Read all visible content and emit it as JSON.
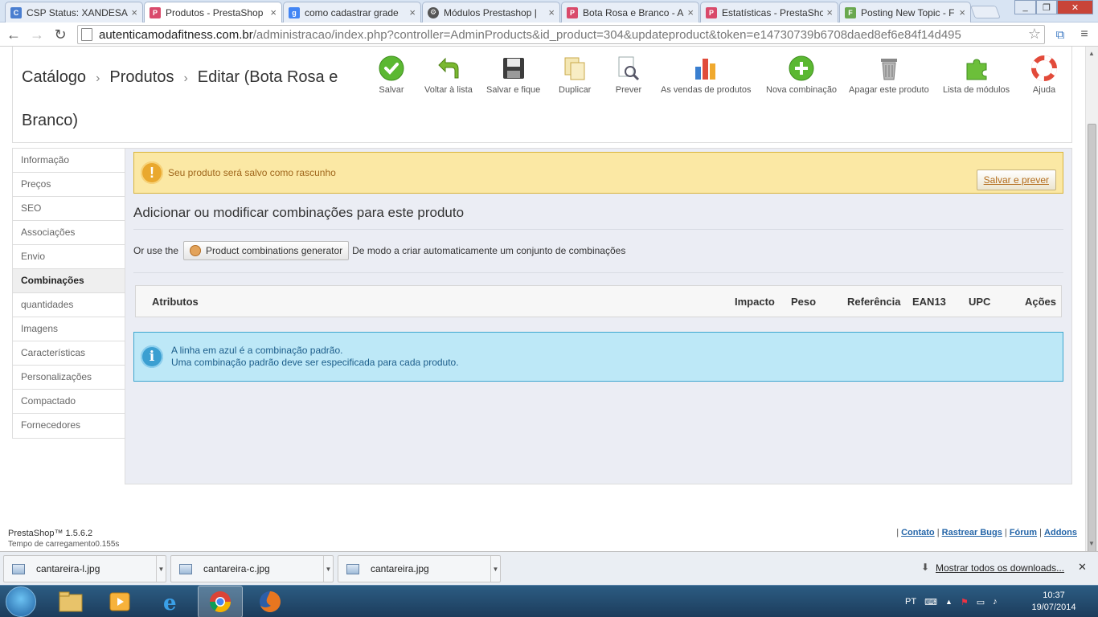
{
  "browser": {
    "tabs": [
      {
        "title": "CSP Status: XANDESA",
        "favicon": "csp",
        "active": false
      },
      {
        "title": "Produtos - PrestaShop",
        "favicon": "prestashop",
        "active": true
      },
      {
        "title": "como cadastrar grade",
        "favicon": "google",
        "active": false
      },
      {
        "title": "Módulos Prestashop |",
        "favicon": "gear",
        "active": false
      },
      {
        "title": "Bota Rosa e Branco - A",
        "favicon": "prestashop",
        "active": false
      },
      {
        "title": "Estatísticas - PrestaSho",
        "favicon": "prestashop",
        "active": false
      },
      {
        "title": "Posting New Topic - F",
        "favicon": "forum",
        "active": false
      }
    ],
    "url_host": "autenticamodafitness.com.br",
    "url_path": "/administracao/index.php?controller=AdminProducts&id_product=304&updateproduct&token=e14730739b6708daed8ef6e84f14d495"
  },
  "breadcrumb": {
    "items": [
      "Catálogo",
      "Produtos",
      "Editar (Bota Rosa e Branco)"
    ],
    "separator": "›"
  },
  "toolbar": {
    "buttons": [
      {
        "label": "Salvar",
        "icon": "check-icon"
      },
      {
        "label": "Voltar à lista",
        "icon": "back-arrow-icon"
      },
      {
        "label": "Salvar e fique",
        "icon": "floppy-icon"
      },
      {
        "label": "Duplicar",
        "icon": "duplicate-icon"
      },
      {
        "label": "Prever",
        "icon": "preview-icon"
      },
      {
        "label": "As vendas de produtos",
        "icon": "bar-chart-icon"
      },
      {
        "label": "Nova combinação",
        "icon": "plus-icon"
      },
      {
        "label": "Apagar este produto",
        "icon": "trash-icon"
      },
      {
        "label": "Lista de módulos",
        "icon": "puzzle-icon"
      },
      {
        "label": "Ajuda",
        "icon": "lifebuoy-icon"
      }
    ]
  },
  "sidetabs": [
    "Informação",
    "Preços",
    "SEO",
    "Associações",
    "Envio",
    "Combinações",
    "quantidades",
    "Imagens",
    "Características",
    "Personalizações",
    "Compactado",
    "Fornecedores"
  ],
  "sidetabs_active": "Combinações",
  "warning": {
    "message": "Seu produto será salvo como rascunho",
    "button": "Salvar e prever"
  },
  "combinations": {
    "title": "Adicionar ou modificar combinações para este produto",
    "or_use": "Or use the",
    "generator_button": "Product combinations generator",
    "generator_suffix": "De modo a criar automaticamente um conjunto de combinações",
    "columns": [
      "Atributos",
      "Impacto",
      "Peso",
      "Referência",
      "EAN13",
      "UPC",
      "Ações"
    ]
  },
  "info": {
    "line1": "A linha em azul é a combinação padrão.",
    "line2": "Uma combinação padrão deve ser especificada para cada produto."
  },
  "footer": {
    "version": "PrestaShop™ 1.5.6.2",
    "load_time": "Tempo de carregamento0.155s",
    "links": [
      "Contato",
      "Rastrear Bugs",
      "Fórum",
      "Addons"
    ]
  },
  "downloads": {
    "files": [
      "cantareira-l.jpg",
      "cantareira-c.jpg",
      "cantareira.jpg"
    ],
    "show_all": "Mostrar todos os downloads..."
  },
  "taskbar": {
    "lang": "PT",
    "time": "10:37",
    "date": "19/07/2014"
  },
  "colors": {
    "warning_bg": "#fbe8a4",
    "info_bg": "#bde8f7",
    "link": "#2465a8"
  }
}
